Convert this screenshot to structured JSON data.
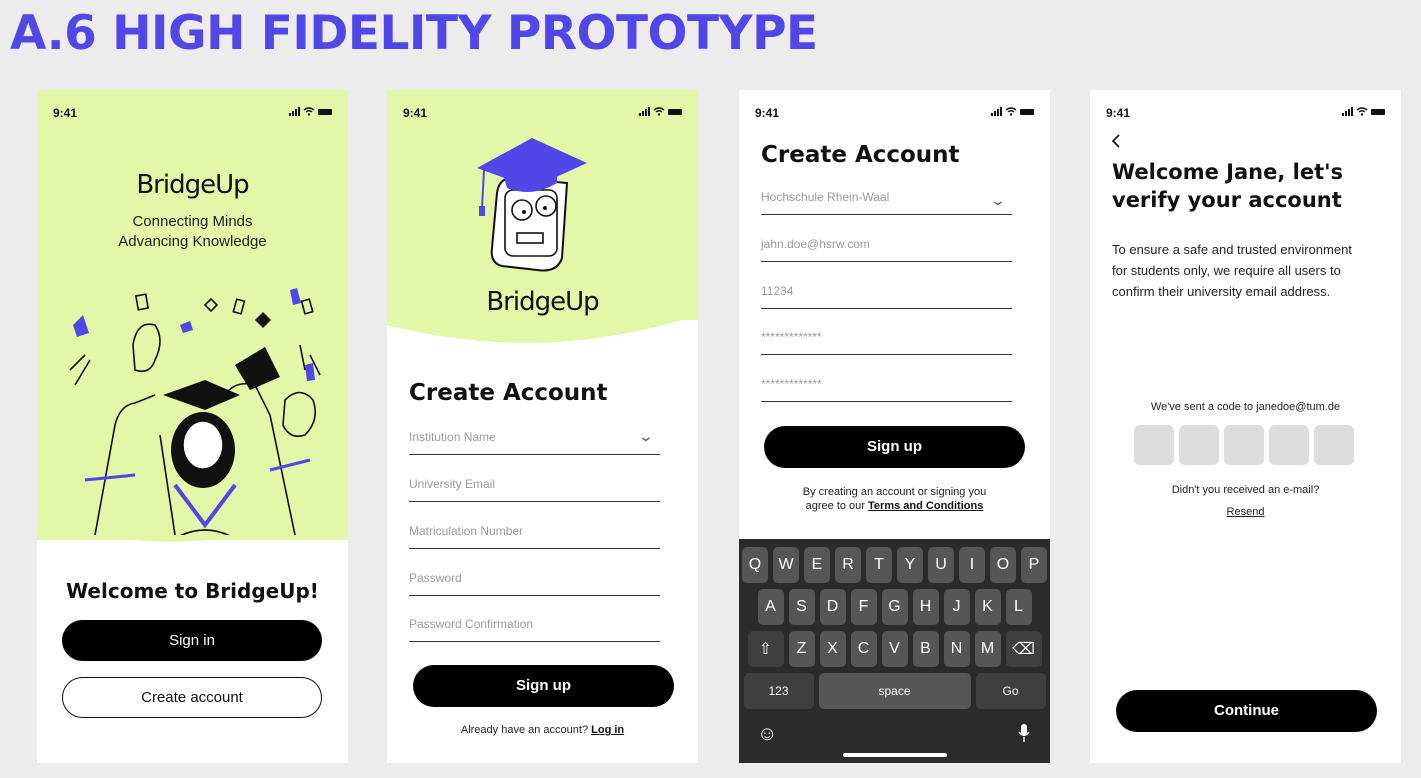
{
  "page": {
    "title": "A.6 HIGH FIDELITY PROTOTYPE"
  },
  "status_bar": {
    "time": "9:41"
  },
  "brand": {
    "name": "BridgeUp",
    "tagline_line1": "Connecting Minds",
    "tagline_line2": "Advancing Knowledge"
  },
  "screen1": {
    "welcome": "Welcome to BridgeUp!",
    "sign_in": "Sign in",
    "create_account": "Create account"
  },
  "screen2": {
    "heading": "Create Account",
    "fields": [
      "Institution Name",
      "University Email",
      "Matriculation Number",
      "Password",
      "Password Confirmation"
    ],
    "sign_up": "Sign up",
    "already": "Already have an account?",
    "login": "Log in"
  },
  "screen3": {
    "heading": "Create Account",
    "fields": [
      "Hochschule Rhein-Waal",
      "jahn.doe@hsrw.com",
      "11234",
      "*************",
      "*************"
    ],
    "sign_up": "Sign up",
    "terms_line1": "By creating an account or signing you",
    "terms_line2": "agree to our",
    "terms_link": "Terms and Conditions",
    "keyboard": {
      "row1": [
        "Q",
        "W",
        "E",
        "R",
        "T",
        "Y",
        "U",
        "I",
        "O",
        "P"
      ],
      "row2": [
        "A",
        "S",
        "D",
        "F",
        "G",
        "H",
        "J",
        "K",
        "L"
      ],
      "row3": [
        "Z",
        "X",
        "C",
        "V",
        "B",
        "N",
        "M"
      ],
      "numbers": "123",
      "space": "space",
      "go": "Go"
    }
  },
  "screen4": {
    "heading_line1": "Welcome Jane, let's",
    "heading_line2": "verify your account",
    "body": "To ensure a safe and trusted environment for students only, we require all users to confirm their university email address.",
    "sent": "We've sent a code to janedoe@tum.de",
    "no_email": "Didn't you received an e-mail?",
    "resend": "Resend",
    "continue": "Continue"
  },
  "colors": {
    "accent": "#5146e8",
    "green": "#e4f6a8",
    "keyboard": "#2b2b2b"
  },
  "icons": [
    "signal-icon",
    "wifi-icon",
    "battery-icon",
    "chevron-down-icon",
    "back-arrow-icon",
    "shift-icon",
    "backspace-icon",
    "emoji-icon",
    "microphone-icon"
  ]
}
